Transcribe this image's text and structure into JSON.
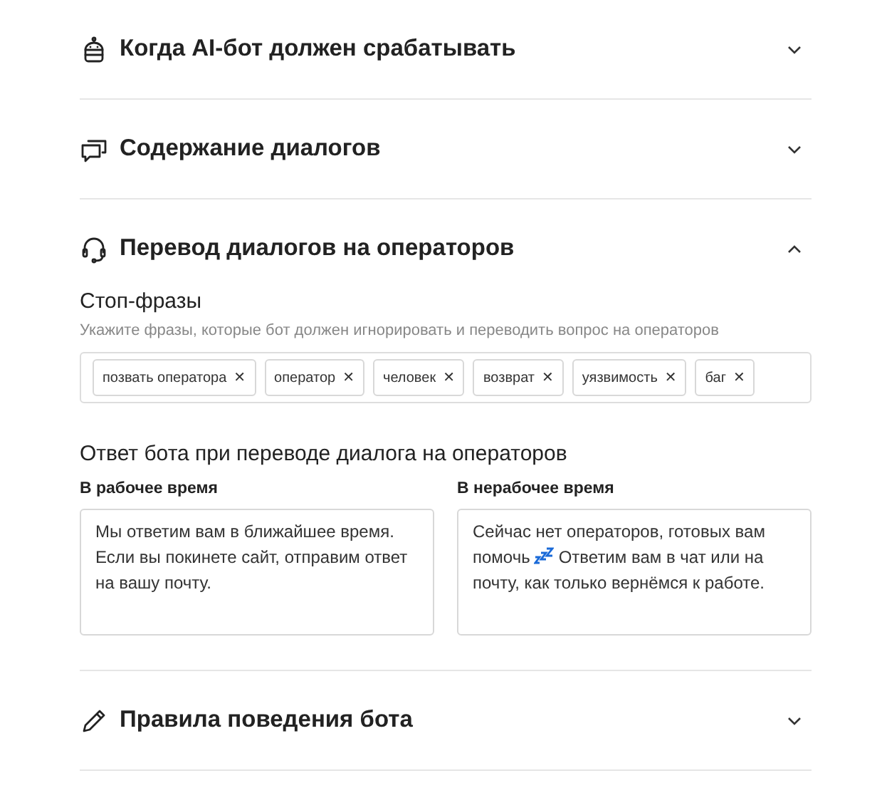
{
  "sections": [
    {
      "kind": "robot",
      "title": "Когда AI-бот должен срабатывать",
      "expanded": false
    },
    {
      "kind": "chat",
      "title": "Содержание диалогов",
      "expanded": false
    },
    {
      "kind": "headset",
      "title": "Перевод диалогов на операторов",
      "expanded": true,
      "stop_phrases": {
        "title": "Стоп-фразы",
        "hint": "Укажите фразы, которые бот должен игнорировать и переводить вопрос на операторов",
        "tags": [
          {
            "label": "позвать оператора",
            "remove": "✕"
          },
          {
            "label": "оператор",
            "remove": "✕"
          },
          {
            "label": "человек",
            "remove": "✕"
          },
          {
            "label": "возврат",
            "remove": "✕"
          },
          {
            "label": "уязвимость",
            "remove": "✕"
          },
          {
            "label": "баг",
            "remove": "✕"
          }
        ]
      },
      "reply": {
        "title": "Ответ бота при переводе диалога на операторов",
        "fields": [
          {
            "label": "В рабочее время",
            "value_parts": [
              "Мы ответим вам в ближайшее время. Если вы покинете сайт, отправим ответ на вашу почту."
            ]
          },
          {
            "label": "В нерабочее время",
            "value_parts": [
              "Сейчас нет операторов, готовых вам помочь",
              "Ответим вам в чат или на почту, как только вернёмся к работе."
            ]
          }
        ]
      }
    },
    {
      "kind": "pencil",
      "title": "Правила поведения бота",
      "expanded": false
    }
  ]
}
